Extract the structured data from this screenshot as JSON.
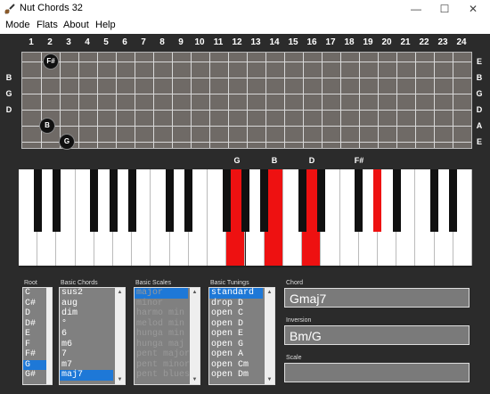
{
  "window": {
    "title": "Nut Chords 32",
    "minimize_glyph": "—",
    "maximize_glyph": "☐",
    "close_glyph": "✕"
  },
  "menu": [
    "Mode",
    "Flats",
    "About",
    "Help"
  ],
  "fretboard": {
    "fret_numbers": [
      "1",
      "2",
      "3",
      "4",
      "5",
      "6",
      "7",
      "8",
      "9",
      "10",
      "11",
      "12",
      "13",
      "14",
      "15",
      "16",
      "17",
      "18",
      "19",
      "20",
      "21",
      "22",
      "23",
      "24"
    ],
    "left_strings": [
      "B",
      "G",
      "D"
    ],
    "right_strings": [
      "E",
      "B",
      "G",
      "D",
      "A",
      "E"
    ],
    "markers": [
      {
        "label": "F#",
        "fret": 2,
        "string": 1
      },
      {
        "label": "B",
        "fret": 2,
        "string": 5
      },
      {
        "label": "G",
        "fret": 3,
        "string": 6
      }
    ]
  },
  "keyboard": {
    "note_labels": [
      "G",
      "B",
      "D",
      "F#"
    ],
    "white_key_count": 24,
    "highlighted_white": [
      11,
      13,
      15
    ],
    "highlighted_black": [
      18
    ]
  },
  "root": {
    "label": "Root",
    "items": [
      "C",
      "C#",
      "D",
      "D#",
      "E",
      "F",
      "F#",
      "G",
      "G#"
    ],
    "selected": 7
  },
  "basic_chords": {
    "label": "Basic Chords",
    "items": [
      "sus2",
      "aug",
      "dim",
      "°",
      "6",
      "m6",
      "7",
      "m7",
      "maj7"
    ],
    "selected": 8
  },
  "basic_scales": {
    "label": "Basic Scales",
    "items": [
      "major",
      "minor",
      "harmo min",
      "melod min",
      "hunga min",
      "hunga maj",
      "pent major",
      "pent minor",
      "pent blues"
    ],
    "selected": 0
  },
  "basic_tunings": {
    "label": "Basic Tunings",
    "items": [
      "standard",
      "drop D",
      "open C",
      "open D",
      "open E",
      "open G",
      "open A",
      "open Cm",
      "open Dm"
    ],
    "selected": 0
  },
  "chord": {
    "label": "Chord",
    "value": "Gmaj7"
  },
  "inversion": {
    "label": "Inversion",
    "value": "Bm/G"
  },
  "scale": {
    "label": "Scale",
    "value": ""
  }
}
